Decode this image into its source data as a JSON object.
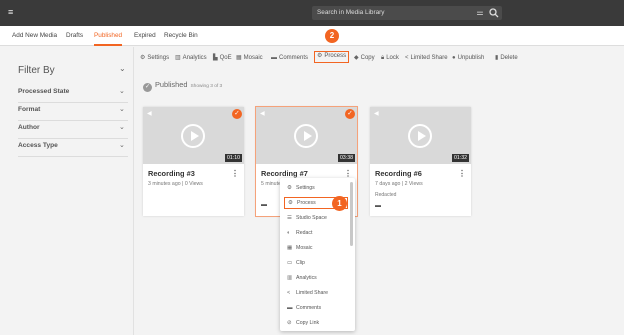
{
  "topbar": {
    "search_placeholder": "Search in Media Library",
    "menu_icon": "hamburger-icon",
    "tune_icon": "sliders-icon",
    "search_icon": "search-icon"
  },
  "tabs": [
    {
      "label": "Add New Media"
    },
    {
      "label": "Drafts"
    },
    {
      "label": "Published",
      "active": true
    },
    {
      "label": "Expired"
    },
    {
      "label": "Recycle Bin"
    }
  ],
  "sidebar": {
    "title": "Filter By",
    "filters": [
      {
        "label": "Processed State"
      },
      {
        "label": "Format"
      },
      {
        "label": "Author"
      },
      {
        "label": "Access Type"
      }
    ]
  },
  "toolbar": {
    "items": [
      {
        "label": "Settings",
        "icon": "gear-icon"
      },
      {
        "label": "Analytics",
        "icon": "analytics-icon"
      },
      {
        "label": "QoE",
        "icon": "qoe-icon"
      },
      {
        "label": "Mosaic",
        "icon": "mosaic-icon"
      },
      {
        "label": "Comments",
        "icon": "comments-icon"
      },
      {
        "label": "Process",
        "icon": "process-icon",
        "highlighted": true
      },
      {
        "label": "Copy",
        "icon": "copy-icon"
      },
      {
        "label": "Lock",
        "icon": "lock-icon"
      },
      {
        "label": "Limited Share",
        "icon": "share-icon"
      },
      {
        "label": "Unpublish",
        "icon": "unpublish-icon"
      },
      {
        "label": "Delete",
        "icon": "trash-icon"
      }
    ],
    "callout": "2"
  },
  "status": {
    "label": "Published",
    "count": "Showing 3 of 3"
  },
  "cards": [
    {
      "title": "Recording #3",
      "duration": "01:10",
      "meta": "3 minutes ago  |  0 Views",
      "selected": true
    },
    {
      "title": "Recording #7",
      "duration": "03:38",
      "meta": "5 minutes ago",
      "selected": true
    },
    {
      "title": "Recording #6",
      "duration": "01:32",
      "meta": "7 days ago  |  2 Views",
      "badge": "Redacted",
      "selected": false
    }
  ],
  "dropdown": {
    "callout": "1",
    "items": [
      {
        "label": "Settings",
        "icon": "gear-icon"
      },
      {
        "label": "Process",
        "icon": "process-icon",
        "highlighted": true
      },
      {
        "label": "Studio Space",
        "icon": "studio-icon"
      },
      {
        "label": "Redact",
        "icon": "redact-icon"
      },
      {
        "label": "Mosaic",
        "icon": "mosaic-icon"
      },
      {
        "label": "Clip",
        "icon": "clip-icon"
      },
      {
        "label": "Analytics",
        "icon": "analytics-icon"
      },
      {
        "label": "Limited Share",
        "icon": "share-icon"
      },
      {
        "label": "Comments",
        "icon": "comments-icon"
      },
      {
        "label": "Copy Link",
        "icon": "link-icon"
      }
    ]
  },
  "colors": {
    "accent": "#f26522",
    "topbar": "#3a3a3a",
    "thumbnail": "#d9d9d9"
  }
}
